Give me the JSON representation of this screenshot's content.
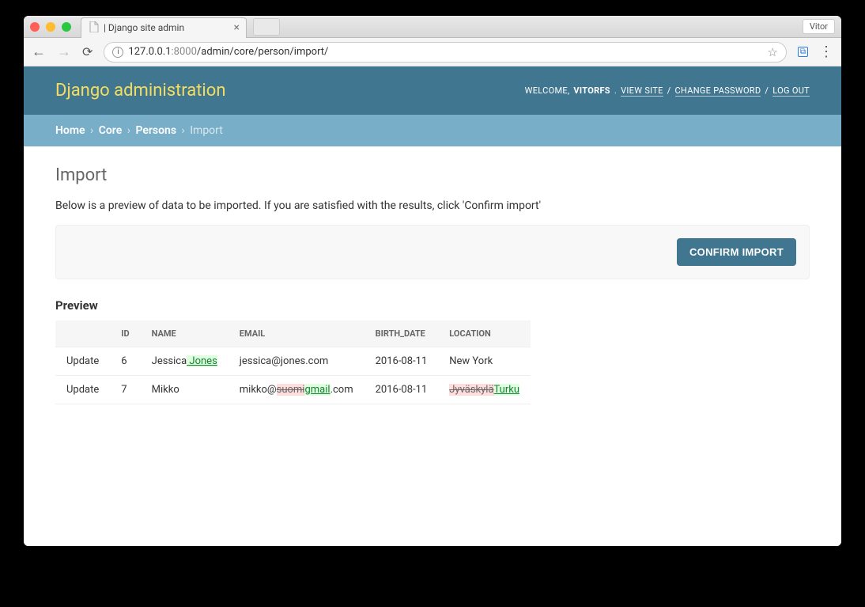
{
  "browser": {
    "tab_title": "| Django site admin",
    "profile_name": "Vitor",
    "url_host": "127.0.0.1",
    "url_port": ":8000",
    "url_path": "/admin/core/person/import/"
  },
  "header": {
    "brand": "Django administration",
    "welcome": "WELCOME,",
    "username": "VITORFS",
    "view_site": "VIEW SITE",
    "change_password": "CHANGE PASSWORD",
    "log_out": "LOG OUT"
  },
  "breadcrumbs": {
    "home": "Home",
    "core": "Core",
    "persons": "Persons",
    "current": "Import"
  },
  "page": {
    "title": "Import",
    "intro": "Below is a preview of data to be imported. If you are satisfied with the results, click 'Confirm import'",
    "confirm_button": "CONFIRM IMPORT",
    "preview_heading": "Preview"
  },
  "table": {
    "columns": {
      "action": "",
      "id": "ID",
      "name": "NAME",
      "email": "EMAIL",
      "birth_date": "BIRTH_DATE",
      "location": "LOCATION"
    },
    "rows": [
      {
        "action": "Update",
        "id": "6",
        "name_before": "Jessica",
        "name_ins": " Jones",
        "email_plain": "jessica@jones.com",
        "birth_date": "2016-08-11",
        "location_plain": "New York"
      },
      {
        "action": "Update",
        "id": "7",
        "name_plain": "Mikko",
        "email_prefix": "mikko@",
        "email_del": "suomi",
        "email_ins": "gmail",
        "email_suffix": ".com",
        "birth_date": "2016-08-11",
        "location_del": "Jyväskylä",
        "location_ins": "Turku"
      }
    ]
  }
}
